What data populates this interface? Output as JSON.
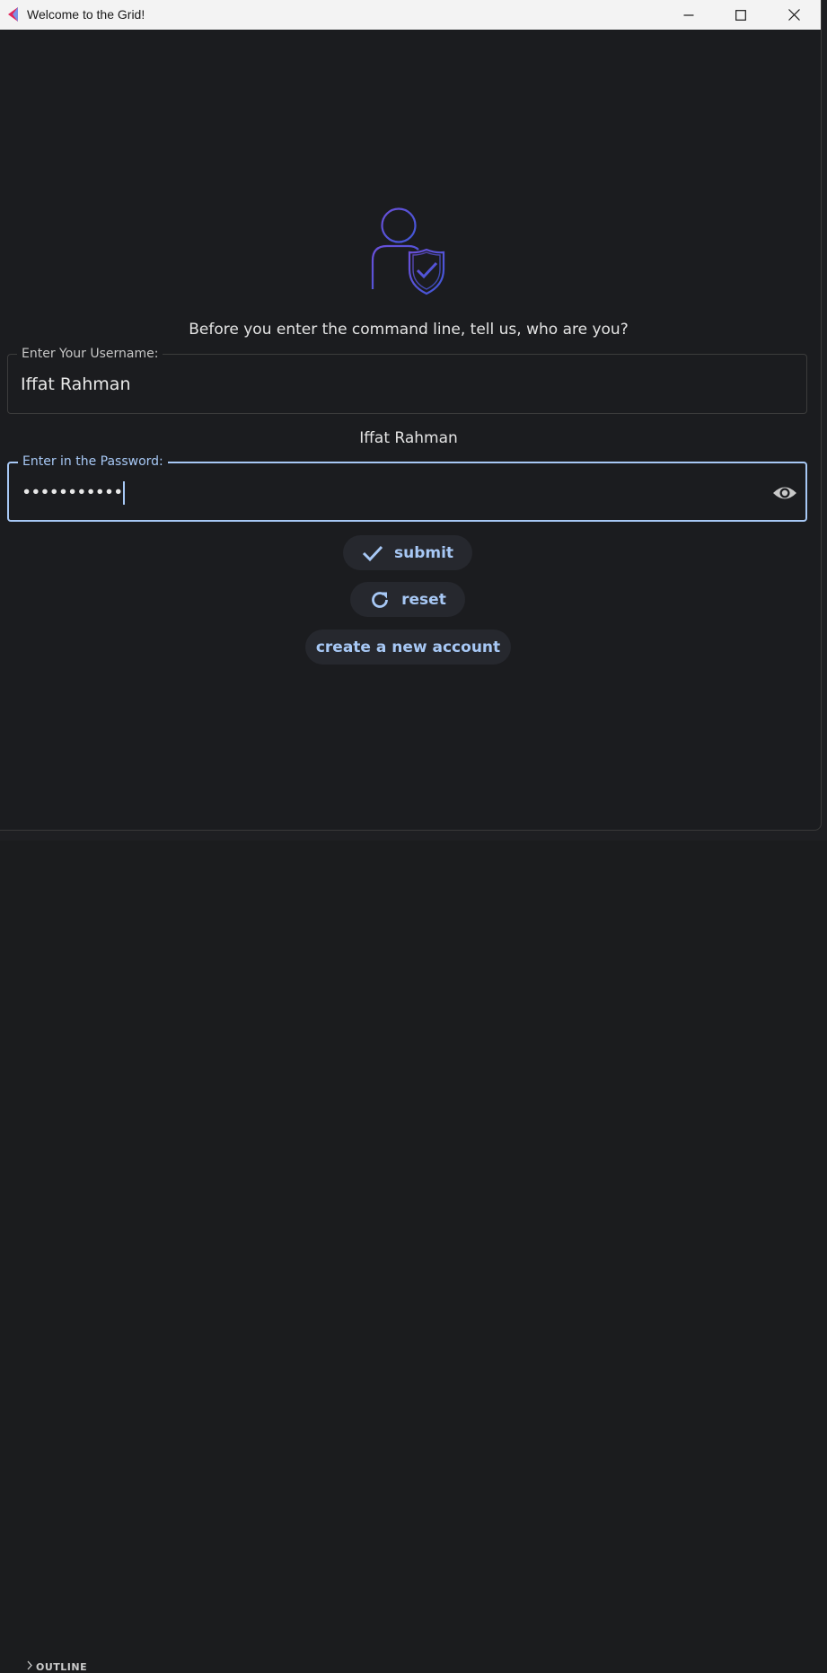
{
  "window": {
    "title": "Welcome to the Grid!",
    "controls": [
      "minimize",
      "maximize",
      "close"
    ]
  },
  "hero": {
    "icon": "user-shield-check-icon"
  },
  "prompt": "Before you enter the command line, tell us, who are you?",
  "username": {
    "label": "Enter Your Username:",
    "value": "Iffat Rahman"
  },
  "echo": "Iffat Rahman",
  "password": {
    "label": "Enter in the Password:",
    "masked_value": "•••••••••••",
    "toggle_icon": "eye-icon"
  },
  "buttons": {
    "submit": "submit",
    "reset": "reset",
    "create": "create a new account"
  },
  "background": {
    "panel_label": "OUTLINE"
  },
  "colors": {
    "accent": "#a7c8f5",
    "background": "#1b1c1f",
    "button_bg": "#26282e",
    "icon_gradient": [
      "#6b4fd8",
      "#3f57d6"
    ]
  }
}
